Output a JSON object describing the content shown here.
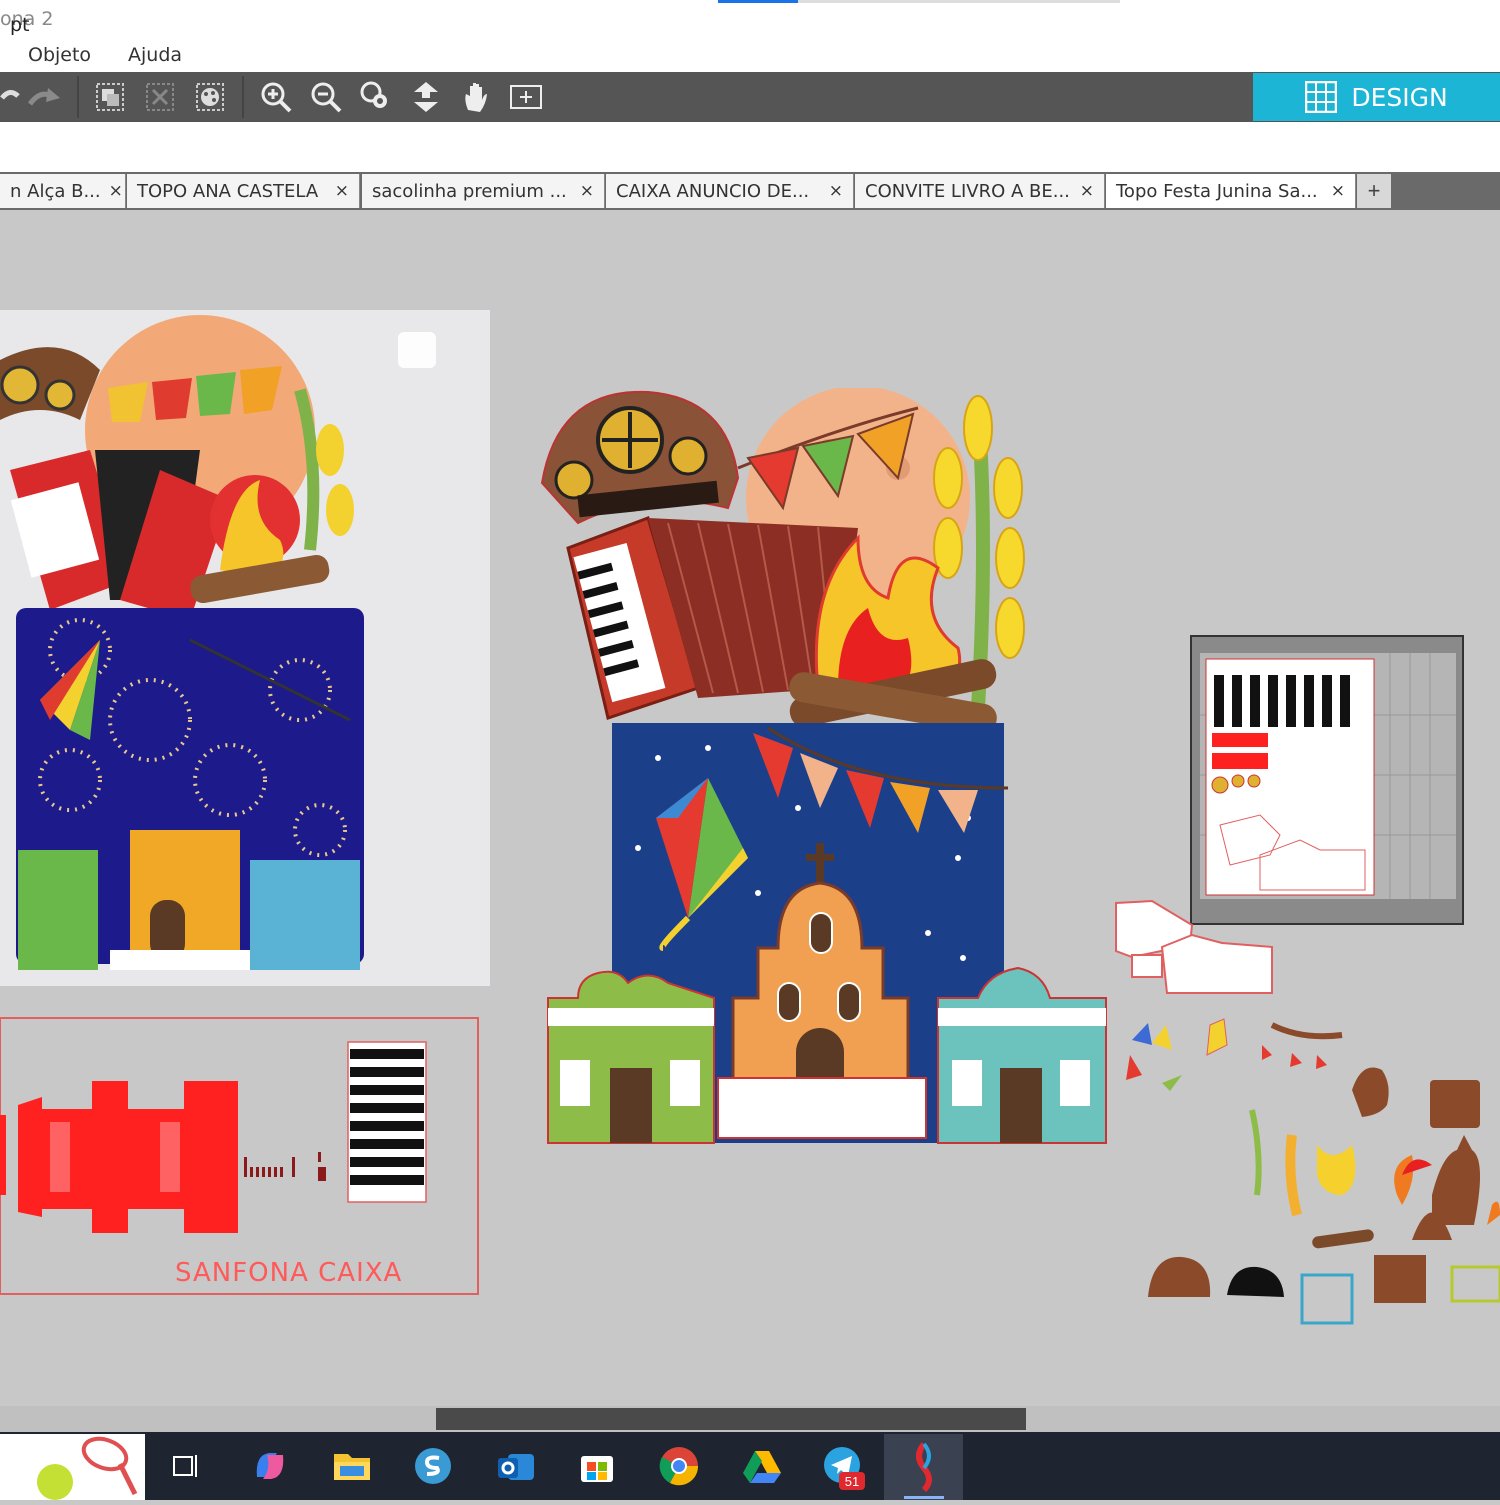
{
  "window": {
    "title_fragment": "ona 2"
  },
  "menu": {
    "items": [
      "Objeto",
      "Ajuda"
    ]
  },
  "toolbar": {
    "design_label": "DESIGN",
    "icons": [
      "undo-icon",
      "redo-icon",
      "group-icon",
      "ungroup-icon",
      "replicate-icon",
      "zoom-in-icon",
      "zoom-out-icon",
      "zoom-fit-icon",
      "pan-down-icon",
      "hand-icon",
      "fit-page-icon",
      "grid-icon"
    ]
  },
  "options": {
    "unit": "pt"
  },
  "tabs": [
    {
      "label": "n Alça B...",
      "active": false
    },
    {
      "label": "TOPO ANA CASTELA",
      "active": false
    },
    {
      "label": "sacolinha premium ...",
      "active": false
    },
    {
      "label": "CAIXA ANUNCIO DE...",
      "active": false
    },
    {
      "label": "CONVITE LIVRO A BE...",
      "active": false
    },
    {
      "label": "Topo Festa Junina Sa...",
      "active": true
    }
  ],
  "tab_add_label": "+",
  "tab_close_glyph": "×",
  "canvas": {
    "sanfona_label": "SANFONA CAIXA",
    "cut_mat": "cut-mat-preview"
  },
  "taskbar": {
    "apps": [
      "widgets",
      "task-view",
      "copilot",
      "file-explorer",
      "silhouette-studio",
      "outlook",
      "store",
      "chrome",
      "google-drive",
      "telegram",
      "silhouette-active"
    ],
    "telegram_badge": "51"
  },
  "colors": {
    "design_accent": "#1cb5d6",
    "toolbar": "#555555",
    "canvas": "#c8c8c8"
  }
}
